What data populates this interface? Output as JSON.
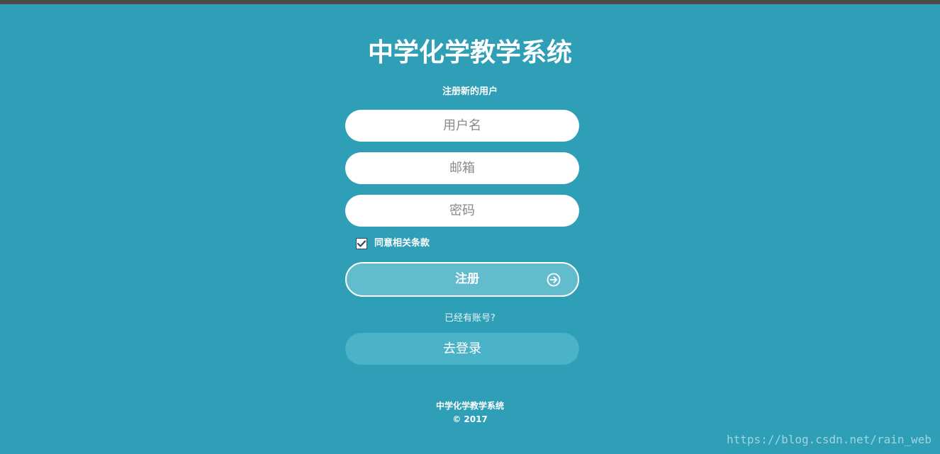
{
  "app": {
    "title": "中学化学教学系统"
  },
  "form": {
    "subtitle": "注册新的用户",
    "username_placeholder": "用户名",
    "email_placeholder": "邮箱",
    "password_placeholder": "密码",
    "agree_checked": true,
    "agree_label": "同意相关条款",
    "register_label": "注册"
  },
  "login": {
    "prompt": "已经有账号?",
    "button_label": "去登录"
  },
  "footer": {
    "name": "中学化学教学系统",
    "copyright": "© 2017"
  },
  "watermark": "https://blog.csdn.net/rain_web",
  "icons": {
    "register_arrow": "arrow-circle-right-icon",
    "checkbox_mark": "check-icon"
  },
  "colors": {
    "background": "#2e9fb6",
    "register_button": "#63bccd",
    "login_button": "#4ab3c7",
    "field": "#ffffff",
    "text": "#ffffff"
  }
}
